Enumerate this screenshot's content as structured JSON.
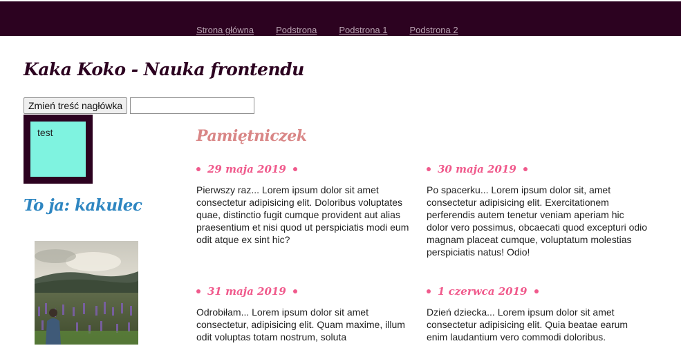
{
  "nav": {
    "items": [
      {
        "label": "Strona główna"
      },
      {
        "label": "Podstrona"
      },
      {
        "label": "Podstrona 1"
      },
      {
        "label": "Podstrona 2"
      }
    ]
  },
  "header": {
    "title": "Kaka Koko - Nauka frontendu",
    "change_button_label": "Zmień treść nagłówka",
    "input_value": ""
  },
  "test_box": {
    "text": "test"
  },
  "about": {
    "title": "To ja: kakulec"
  },
  "diary": {
    "title": "Pamiętniczek",
    "entries": [
      {
        "date": "29 maja 2019",
        "text": "Pierwszy raz... Lorem ipsum dolor sit amet consectetur adipisicing elit. Doloribus voluptates quae, distinctio fugit cumque provident aut alias praesentium et nisi quod ut perspiciatis modi eum odit atque ex sint hic?"
      },
      {
        "date": "30 maja 2019",
        "text": "Po spacerku... Lorem ipsum dolor sit, amet consectetur adipisicing elit. Exercitationem perferendis autem tenetur veniam aperiam hic dolor vero possimus, obcaecati quod excepturi odio magnam placeat cumque, voluptatum molestias perspiciatis natus! Odio!"
      },
      {
        "date": "31 maja 2019",
        "text": "Odrobiłam... Lorem ipsum dolor sit amet consectetur, adipisicing elit. Quam maxime, illum odit voluptas totam nostrum, soluta"
      },
      {
        "date": "1 czerwca 2019",
        "text": "Dzień dziecka... Lorem ipsum dolor sit amet consectetur adipisicing elit. Quia beatae earum enim laudantium vero commodi doloribus."
      }
    ]
  },
  "colors": {
    "topbar": "#2c0220",
    "test_box_fill": "#7ff3e0",
    "about_title": "#2e86c1",
    "diary_title": "#d98686",
    "entry_date": "#f05a8c"
  }
}
